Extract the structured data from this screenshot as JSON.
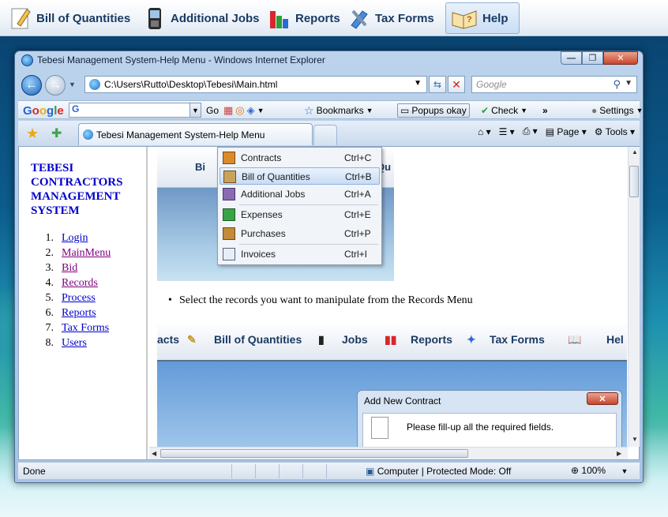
{
  "app_toolbar": {
    "items": [
      {
        "label": "Bill of Quantities",
        "icon": "pencil-paper-icon"
      },
      {
        "label": "Additional Jobs",
        "icon": "phone-icon"
      },
      {
        "label": "Reports",
        "icon": "bar-chart-icon"
      },
      {
        "label": "Tax Forms",
        "icon": "tools-icon"
      },
      {
        "label": "Help",
        "icon": "book-help-icon"
      }
    ]
  },
  "window": {
    "title": "Tebesi Management System-Help Menu - Windows Internet Explorer",
    "min": "—",
    "max": "❐",
    "close": "✕"
  },
  "nav": {
    "address": "C:\\Users\\Rutto\\Desktop\\Tebesi\\Main.html",
    "search_placeholder": "Google"
  },
  "google_bar": {
    "logo": "Google",
    "input_value": "G",
    "go": "Go",
    "bookmarks": "Bookmarks",
    "popups": "Popups okay",
    "check": "Check",
    "more": "»",
    "settings": "Settings"
  },
  "tabs": {
    "active": "Tebesi Management System-Help Menu",
    "page": "Page",
    "tools": "Tools"
  },
  "left_frame": {
    "title": "TEBESI CONTRACTORS MANAGEMENT SYSTEM",
    "links": [
      {
        "num": "1.",
        "label": "Login"
      },
      {
        "num": "2.",
        "label": "MainMenu"
      },
      {
        "num": "3.",
        "label": "Bid"
      },
      {
        "num": "4.",
        "label": "Records"
      },
      {
        "num": "5.",
        "label": "Process"
      },
      {
        "num": "6.",
        "label": "Reports"
      },
      {
        "num": "7.",
        "label": "Tax Forms"
      },
      {
        "num": "8.",
        "label": "Users"
      }
    ]
  },
  "menu": {
    "items": [
      {
        "label": "Contracts",
        "shortcut": "Ctrl+C"
      },
      {
        "label": "Bill of Quantities",
        "shortcut": "Ctrl+B"
      },
      {
        "label": "Additional Jobs",
        "shortcut": "Ctrl+A"
      },
      {
        "label": "Expenses",
        "shortcut": "Ctrl+E"
      },
      {
        "label": "Purchases",
        "shortcut": "Ctrl+P"
      },
      {
        "label": "Invoices",
        "shortcut": "Ctrl+I"
      }
    ],
    "bg_left": "Bi",
    "bg_right": "Qu"
  },
  "content": {
    "bullet": "Select the records you want to manipulate from the Records Menu",
    "screenshot_bar": [
      "acts",
      "Bill of Quantities",
      "Jobs",
      "Reports",
      "Tax Forms",
      "Hel"
    ],
    "dialog_title": "Add New Contract",
    "dialog_close": "✕",
    "dialog_msg": "Please fill-up all the required fields."
  },
  "status": {
    "left": "Done",
    "zone": "Computer | Protected Mode: Off",
    "zoom": "100%"
  }
}
